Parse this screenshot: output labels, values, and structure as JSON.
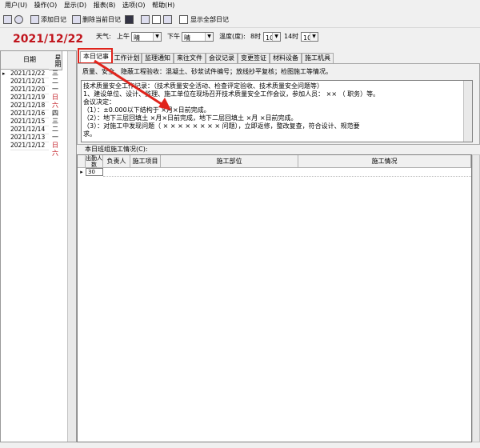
{
  "menu": [
    "用户(U)",
    "操作(O)",
    "显示(D)",
    "报表(B)",
    "选项(O)",
    "帮助(H)"
  ],
  "toolbar": {
    "add_label": "添加日记",
    "delete_label": "删除当前日记",
    "show_all_label": "显示全部日记"
  },
  "current_date": "2021/12/22",
  "diary_list": {
    "col_date": "日期",
    "col_weekday": "星期",
    "rows": [
      {
        "date": "2021/12/22",
        "weekday": "三",
        "color": "#000000"
      },
      {
        "date": "2021/12/21",
        "weekday": "二",
        "color": "#000000"
      },
      {
        "date": "2021/12/20",
        "weekday": "一",
        "color": "#000000"
      },
      {
        "date": "2021/12/19",
        "weekday": "日",
        "color": "#c0141c"
      },
      {
        "date": "2021/12/18",
        "weekday": "六",
        "color": "#c0141c"
      },
      {
        "date": "2021/12/16",
        "weekday": "四",
        "color": "#000000"
      },
      {
        "date": "2021/12/15",
        "weekday": "三",
        "color": "#000000"
      },
      {
        "date": "2021/12/14",
        "weekday": "二",
        "color": "#000000"
      },
      {
        "date": "2021/12/13",
        "weekday": "一",
        "color": "#000000"
      },
      {
        "date": "2021/12/12",
        "weekday": "日",
        "color": "#c0141c"
      },
      {
        "date": "",
        "weekday": "六",
        "color": "#c0141c"
      }
    ]
  },
  "weather": {
    "label": "天气:",
    "am_label": "上午",
    "am_value": "晴",
    "pm_label": "下午",
    "pm_value": "晴",
    "temp_label": "温度(度):",
    "t8_label": "8时",
    "t8_value": "10",
    "t14_label": "14时",
    "t14_value": "10"
  },
  "tabs": [
    "本日记事",
    "工作计划",
    "监理通知",
    "来往文件",
    "会议记录",
    "变更签证",
    "材料设备",
    "施工机具"
  ],
  "subtabs_text": "质量、安全、隐蔽工程验收：混凝土、砂浆试件编号；放线抄平复核；检图施工等情况。",
  "diary_lines": [
    "技术质量安全工作记录：（技术质量安全活动、检查评定验收、技术质量安全问题等）",
    "1、建设单位、设计、监理、施工单位在现场召开技术质量安全工作会议，参加人员：           ××  （  职务）等。",
    "会议决定：",
    "（1）：±0.000以下结构于 ×月×日前完成。",
    "（2）：地下三层回填土   ×月×日前完成，地下二层回填土  ×月 ×日前完成。",
    "（3）：对施工中发现问题（         × × × × × × × ×  问题），立即返修，整改复查，符合设计、规范要",
    "求。"
  ],
  "lower_caption": "本日班组施工情况(C):",
  "grid": {
    "headers": [
      "出勤人数",
      "负责人",
      "施工项目",
      "施工部位",
      "施工情况"
    ],
    "first_value": "30"
  },
  "colors": {
    "accent_red": "#e0241c",
    "date_red": "#c0141c"
  }
}
